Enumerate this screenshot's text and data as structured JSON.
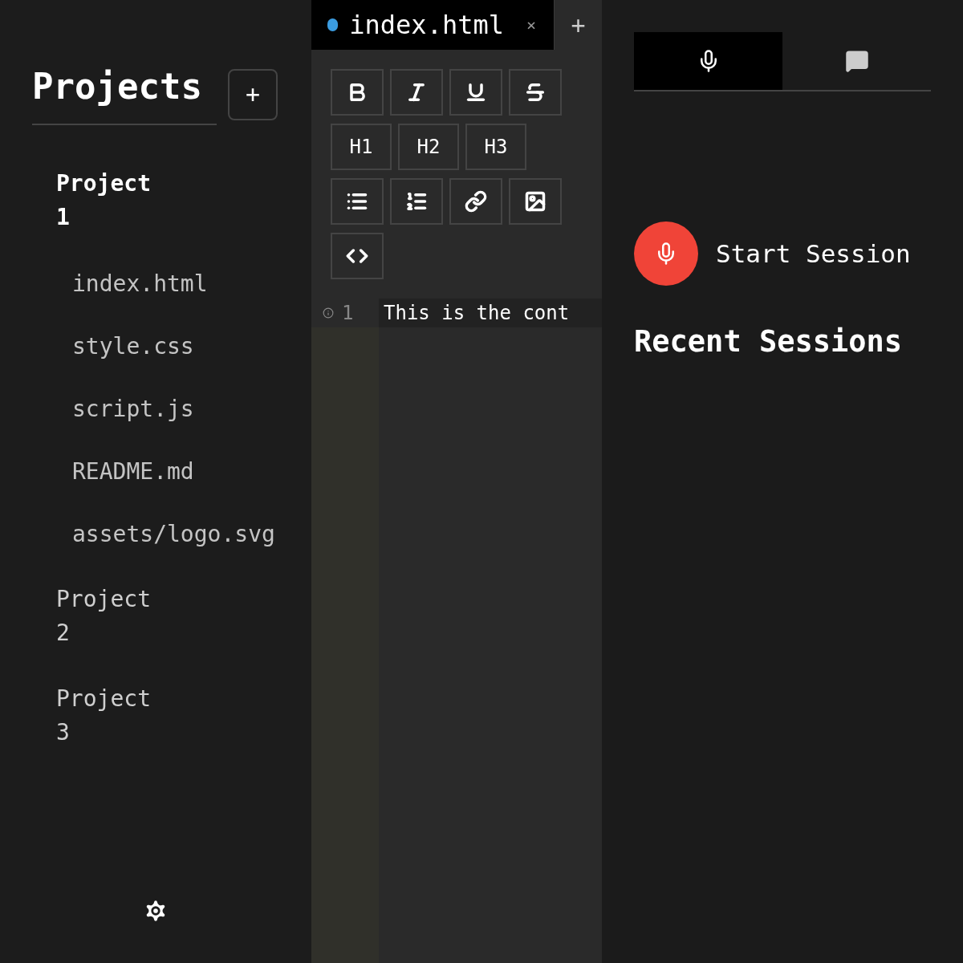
{
  "sidebar": {
    "title": "Projects",
    "add_button": "+",
    "projects": [
      {
        "name": "Project 1",
        "expanded": true,
        "children": [
          {
            "name": "index.html"
          },
          {
            "name": "style.css"
          },
          {
            "name": "script.js"
          },
          {
            "name": "README.md"
          },
          {
            "name": "assets/logo.svg"
          }
        ]
      },
      {
        "name": "Project 2",
        "expanded": false
      },
      {
        "name": "Project 3",
        "expanded": false
      }
    ]
  },
  "editor": {
    "tabs": [
      {
        "label": "index.html",
        "selected": true,
        "modified": true,
        "close": "×"
      }
    ],
    "add_tab": "+",
    "toolbar": [
      [
        {
          "kind": "bold"
        },
        {
          "kind": "italic"
        },
        {
          "kind": "underline"
        },
        {
          "kind": "strike"
        }
      ],
      [
        {
          "kind": "text",
          "label": "H1"
        },
        {
          "kind": "text",
          "label": "H2"
        },
        {
          "kind": "text",
          "label": "H3"
        }
      ],
      [
        {
          "kind": "bullets"
        },
        {
          "kind": "numbers"
        },
        {
          "kind": "link"
        },
        {
          "kind": "image"
        }
      ],
      [
        {
          "kind": "code"
        }
      ]
    ],
    "lines": [
      {
        "number": "1",
        "text": "This is the cont"
      }
    ]
  },
  "panel": {
    "tabs": [
      {
        "kind": "mic",
        "selected": true
      },
      {
        "kind": "chat",
        "selected": false
      }
    ],
    "start_button": "Start Session",
    "recent_title": "Recent Sessions"
  }
}
